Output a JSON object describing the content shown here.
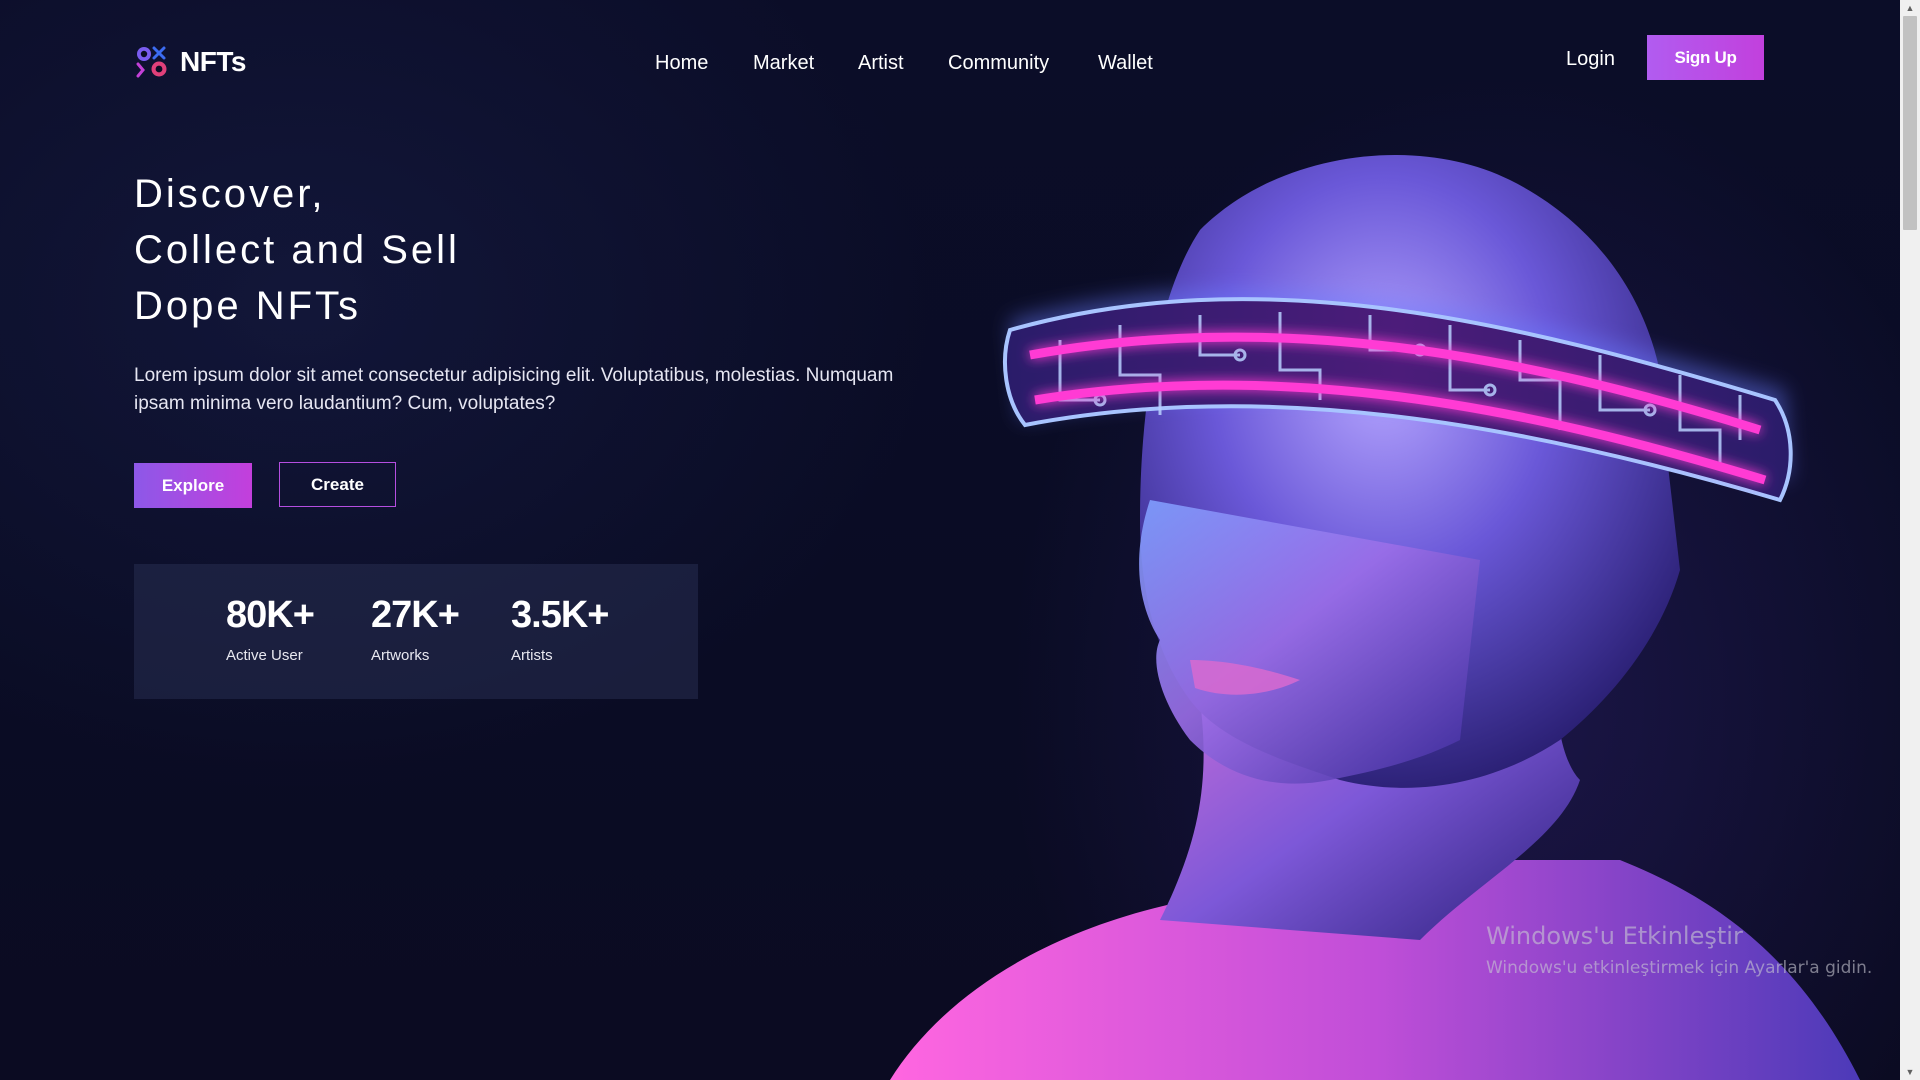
{
  "header": {
    "logo_text": "NFTs",
    "nav": [
      "Home",
      "Market",
      "Artist",
      "Community",
      "Wallet"
    ],
    "login_label": "Login",
    "signup_label": "Sign Up"
  },
  "hero": {
    "headline": [
      "Discover,",
      "Collect and Sell",
      "Dope NFTs"
    ],
    "lead": "Lorem ipsum dolor sit amet consectetur adipisicing elit. Voluptatibus, molestias. Numquam ipsam minima vero laudantium? Cum, voluptates?",
    "explore_label": "Explore",
    "create_label": "Create"
  },
  "stats": [
    {
      "value": "80K+",
      "label": "Active User"
    },
    {
      "value": "27K+",
      "label": "Artworks"
    },
    {
      "value": "3.5K+",
      "label": "Artists"
    }
  ],
  "watermark": {
    "title": "Windows'u Etkinleştir",
    "subtitle": "Windows'u etkinleştirmek için Ayarlar'a gidin."
  },
  "colors": {
    "background": "#0a0c24",
    "accent_purple": "#b15cf0",
    "accent_magenta": "#c240dd",
    "neon_pink": "#ff3bd4"
  },
  "icons": {
    "logo": "nft-logo-icon"
  }
}
